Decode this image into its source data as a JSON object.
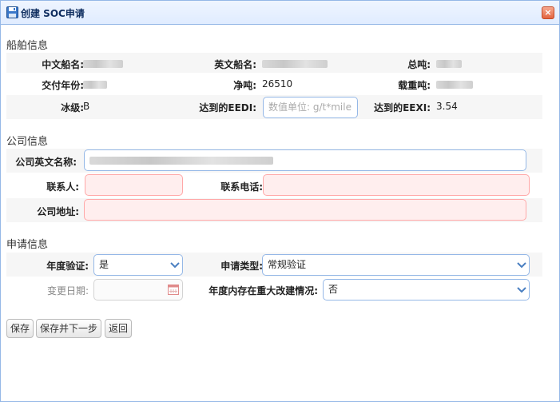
{
  "window": {
    "title": "创建 SOC申请",
    "close_symbol": "×"
  },
  "ship_section": {
    "title": "船舶信息",
    "fields": {
      "cn_name_label": "中文船名:",
      "en_name_label": "英文船名:",
      "gt_label": "总吨:",
      "delivery_year_label": "交付年份:",
      "net_tonnage_label": "净吨:",
      "net_tonnage_value": "26510",
      "dwt_label": "载重吨:",
      "ice_class_label": "冰级:",
      "ice_class_value": "B",
      "eedi_label": "达到的EEDI:",
      "eedi_placeholder": "数值单位: g/t*mile",
      "eexi_label": "达到的EEXI:",
      "eexi_value": "3.54"
    }
  },
  "company_section": {
    "title": "公司信息",
    "fields": {
      "company_en_name_label": "公司英文名称:",
      "contact_label": "联系人:",
      "phone_label": "联系电话:",
      "address_label": "公司地址:"
    }
  },
  "application_section": {
    "title": "申请信息",
    "fields": {
      "annual_verification_label": "年度验证:",
      "annual_verification_value": "是",
      "application_type_label": "申请类型:",
      "application_type_value": "常规验证",
      "change_date_label": "变更日期:",
      "major_modification_label": "年度内存在重大改建情况:",
      "major_modification_value": "否"
    }
  },
  "buttons": {
    "save": "保存",
    "save_next": "保存并下一步",
    "back": "返回"
  },
  "colors": {
    "border": "#95b8e7",
    "invalid_bg": "#ffeeee",
    "invalid_border": "#ffa8a8",
    "title_text": "#0e2d5f"
  }
}
